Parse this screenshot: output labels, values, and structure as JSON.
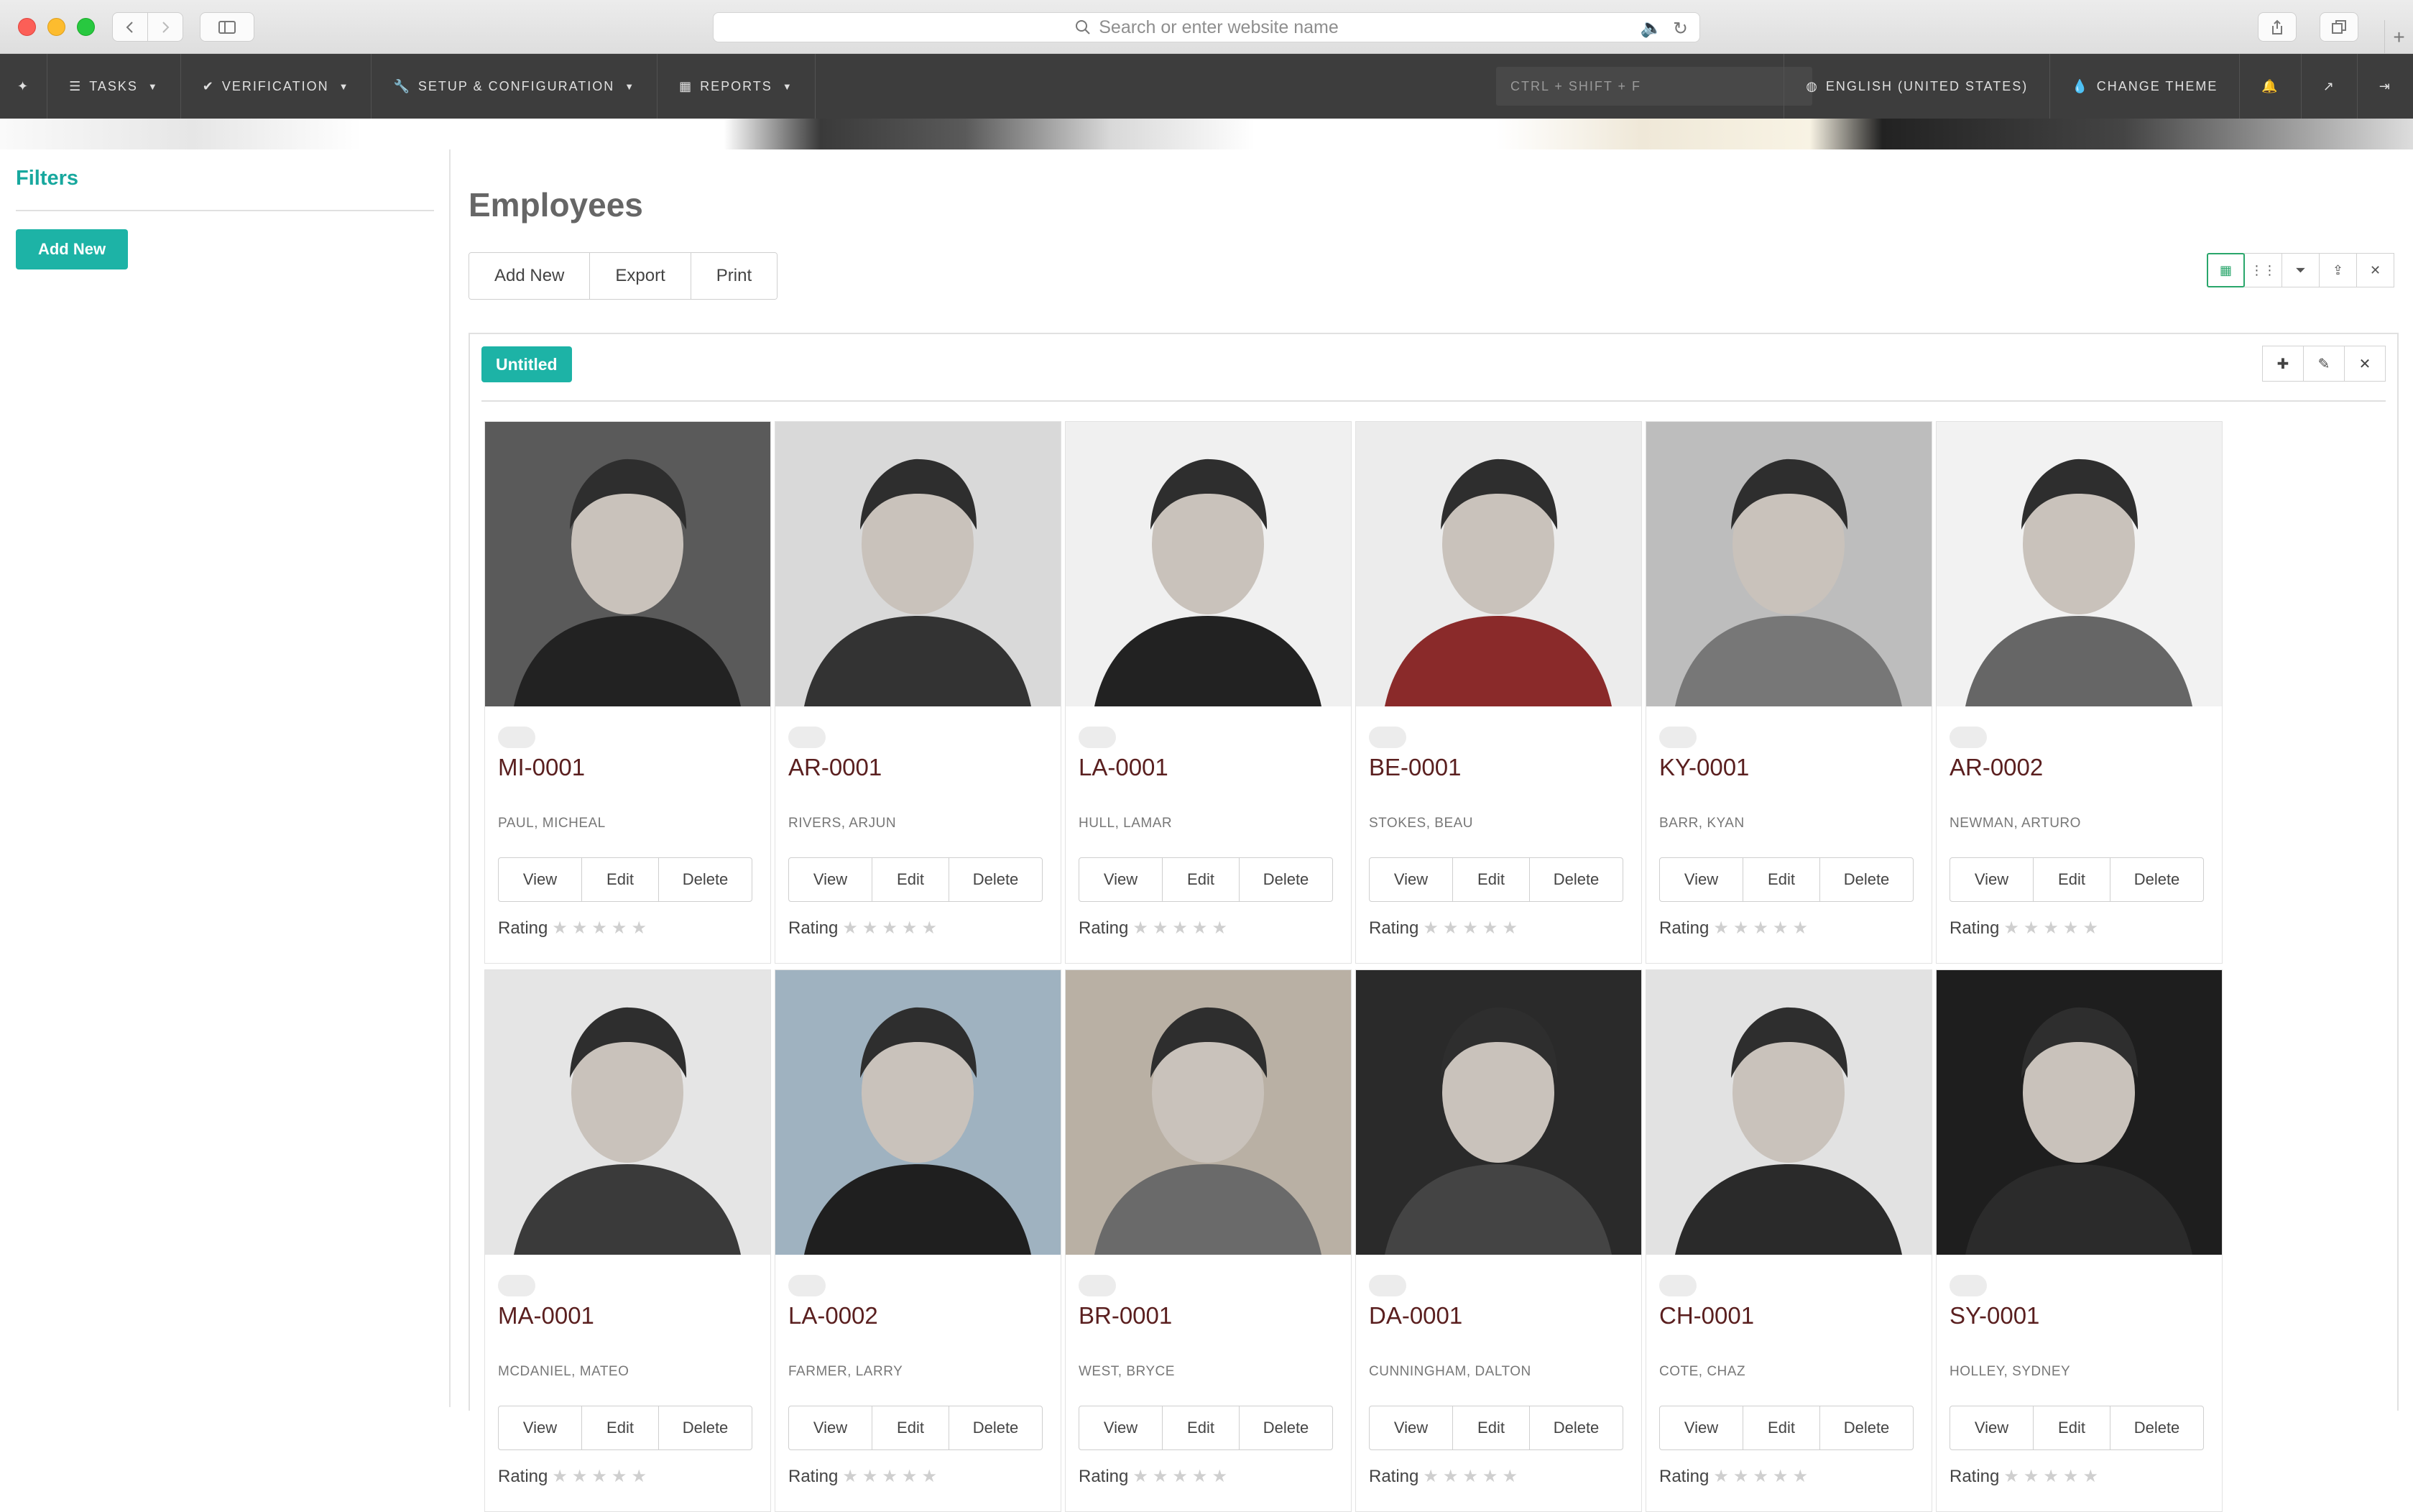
{
  "browser": {
    "address_placeholder": "Search or enter website name"
  },
  "nav": {
    "tasks": "TASKS",
    "verification": "VERIFICATION",
    "setup": "SETUP & CONFIGURATION",
    "reports": "REPORTS",
    "shortcut": "CTRL + SHIFT + F",
    "language": "ENGLISH (UNITED STATES)",
    "theme": "CHANGE THEME"
  },
  "sidebar": {
    "title": "Filters",
    "add_new": "Add New"
  },
  "main": {
    "title": "Employees",
    "buttons": {
      "add_new": "Add New",
      "export": "Export",
      "print": "Print"
    },
    "panel_tag": "Untitled"
  },
  "card_labels": {
    "view": "View",
    "edit": "Edit",
    "delete": "Delete",
    "rating": "Rating"
  },
  "employees": [
    {
      "code": "MI-0001",
      "name": "PAUL, MICHEAL",
      "rating": 0
    },
    {
      "code": "AR-0001",
      "name": "RIVERS, ARJUN",
      "rating": 0
    },
    {
      "code": "LA-0001",
      "name": "HULL, LAMAR",
      "rating": 0
    },
    {
      "code": "BE-0001",
      "name": "STOKES, BEAU",
      "rating": 0
    },
    {
      "code": "KY-0001",
      "name": "BARR, KYAN",
      "rating": 0
    },
    {
      "code": "AR-0002",
      "name": "NEWMAN, ARTURO",
      "rating": 0
    },
    {
      "code": "MA-0001",
      "name": "MCDANIEL, MATEO",
      "rating": 0
    },
    {
      "code": "LA-0002",
      "name": "FARMER, LARRY",
      "rating": 0
    },
    {
      "code": "BR-0001",
      "name": "WEST, BRYCE",
      "rating": 0
    },
    {
      "code": "DA-0001",
      "name": "CUNNINGHAM, DALTON",
      "rating": 0
    },
    {
      "code": "CH-0001",
      "name": "COTE, CHAZ",
      "rating": 0
    },
    {
      "code": "SY-0001",
      "name": "HOLLEY, SYDNEY",
      "rating": 0
    }
  ],
  "colors": {
    "accent": "#1db3a6",
    "code_text": "#5a1f1f",
    "nav_bg": "#3d3d3d"
  }
}
